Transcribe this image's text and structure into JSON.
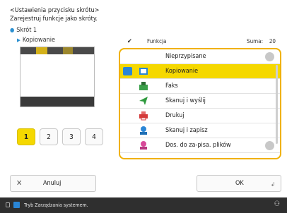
{
  "header": {
    "title": "<Ustawienia przycisku skrótu>",
    "subtitle": "Zarejestruj funkcje jako skróty."
  },
  "shortcut": {
    "name": "Skrót 1",
    "function": "Kopiowanie"
  },
  "pages": [
    "1",
    "2",
    "3",
    "4"
  ],
  "active_page": "1",
  "list_header": {
    "function_label": "Funkcja",
    "sum_label": "Suma:",
    "sum_value": "20"
  },
  "functions": [
    {
      "label": "Nieprzypisane",
      "icon": "none",
      "selected": false
    },
    {
      "label": "Kopiowanie",
      "icon": "copy-icon",
      "selected": true
    },
    {
      "label": "Faks",
      "icon": "fax-icon",
      "selected": false
    },
    {
      "label": "Skanuj i wyślij",
      "icon": "scan-send-icon",
      "selected": false
    },
    {
      "label": "Drukuj",
      "icon": "print-icon",
      "selected": false
    },
    {
      "label": "Skanuj i zapisz",
      "icon": "scan-store-icon",
      "selected": false
    },
    {
      "label": "Dos. do za-pisa. plików",
      "icon": "access-stored-files-icon",
      "selected": false
    }
  ],
  "buttons": {
    "cancel": "Anuluj",
    "ok": "OK"
  },
  "status_bar": {
    "text": "Tryb Zarządzania systemem."
  },
  "colors": {
    "selection": "#f5d800",
    "list_border": "#f0b100",
    "accent_blue": "#2a86d6"
  }
}
